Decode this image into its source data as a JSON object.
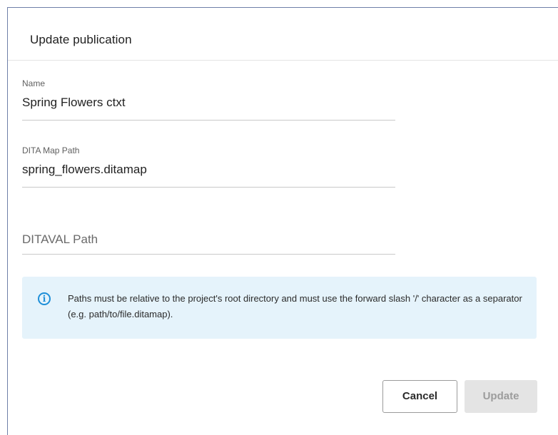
{
  "dialog": {
    "title": "Update publication"
  },
  "fields": {
    "name": {
      "label": "Name",
      "value": "Spring Flowers ctxt"
    },
    "dita_map_path": {
      "label": "DITA Map Path",
      "value": "spring_flowers.ditamap"
    },
    "ditaval_path": {
      "placeholder": "DITAVAL Path",
      "value": ""
    }
  },
  "info": {
    "icon": "info-icon",
    "text": "Paths must be relative to the project's root directory and must use the forward slash '/' character as a separator (e.g. path/to/file.ditamap)."
  },
  "buttons": {
    "cancel_label": "Cancel",
    "update_label": "Update"
  },
  "colors": {
    "info_background": "#e5f3fb",
    "info_icon": "#1e8fd8",
    "update_disabled_background": "#e4e4e4"
  }
}
